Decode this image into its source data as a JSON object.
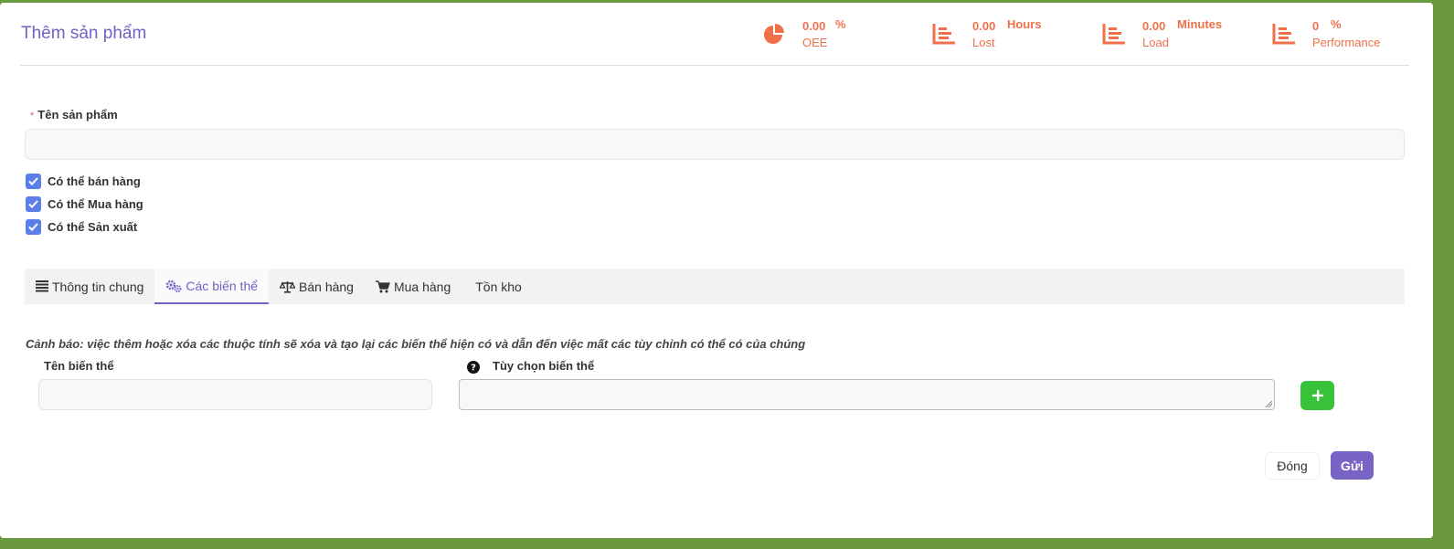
{
  "header": {
    "title": "Thêm sản phẩm",
    "stats": [
      {
        "icon": "pie-chart-icon",
        "value": "0.00",
        "unit": "%",
        "label": "OEE"
      },
      {
        "icon": "bar-chart-icon",
        "value": "0.00",
        "unit": "Hours",
        "label": "Lost"
      },
      {
        "icon": "bar-chart-icon",
        "value": "0.00",
        "unit": "Minutes",
        "label": "Load"
      },
      {
        "icon": "bar-chart-icon",
        "value": "0",
        "unit": "%",
        "label": "Performance"
      }
    ],
    "accent_color": "#f0704a"
  },
  "form": {
    "name_label": "Tên sản phẩm",
    "name_required_mark": "*",
    "name_value": "",
    "checkboxes": [
      {
        "label": "Có thể bán hàng",
        "checked": true
      },
      {
        "label": "Có thể Mua hàng",
        "checked": true
      },
      {
        "label": "Có thể Sản xuất",
        "checked": true
      }
    ]
  },
  "tabs": [
    {
      "label": "Thông tin chung",
      "icon": "list-icon",
      "active": false
    },
    {
      "label": "Các biến thể",
      "icon": "gears-icon",
      "active": true
    },
    {
      "label": "Bán hàng",
      "icon": "scale-icon",
      "active": false
    },
    {
      "label": "Mua hàng",
      "icon": "cart-icon",
      "active": false
    },
    {
      "label": "Tồn kho",
      "icon": "",
      "active": false
    }
  ],
  "variants": {
    "warning": "Cảnh báo: việc thêm hoặc xóa các thuộc tính sẽ xóa và tạo lại các biến thể hiện có và dẫn đến việc mất các tùy chỉnh có thể có của chúng",
    "name_label": "Tên biến thể",
    "name_value": "",
    "options_label": "Tùy chọn biến thể",
    "options_value": ""
  },
  "actions": {
    "close_label": "Đóng",
    "submit_label": "Gửi"
  },
  "colors": {
    "brand": "#6f63c4",
    "checkbox": "#5b7ee8",
    "add_button": "#37c23a",
    "submit_button": "#7864c4"
  }
}
